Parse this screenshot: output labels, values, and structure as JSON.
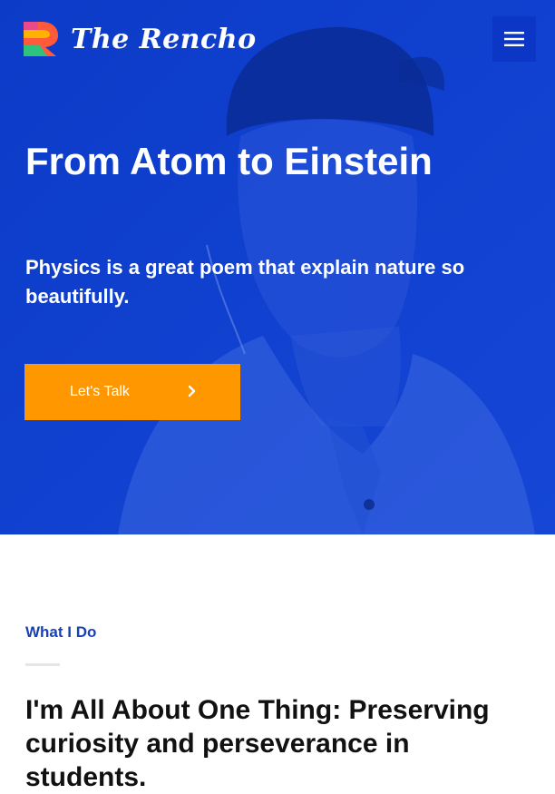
{
  "header": {
    "logo_text": "The Rencho",
    "logo_icon": "rencho-logo-icon",
    "menu_icon": "hamburger-menu-icon"
  },
  "hero": {
    "title": "From Atom to Einstein",
    "subtitle": "Physics is a great poem that explain nature so beautifully.",
    "cta_label": "Let's Talk",
    "cta_icon": "chevron-right-icon",
    "background_color": "#0b3fd1",
    "cta_color": "#ff9800"
  },
  "section": {
    "label": "What I Do",
    "heading": "I'm All About One Thing: Preserving curiosity and perseverance in students.",
    "label_color": "#1a40b8"
  }
}
